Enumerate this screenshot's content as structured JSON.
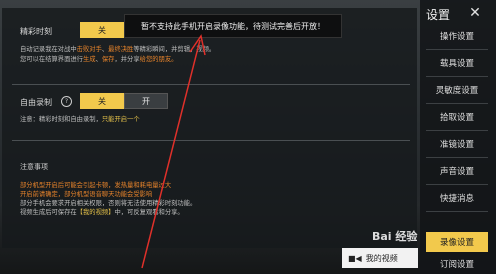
{
  "highlight": {
    "label": "精彩时刻",
    "on": "关",
    "off": "开",
    "desc_line1_a": "自动记录我在对战中",
    "desc_line1_b": "击败对手",
    "desc_line1_c": "、",
    "desc_line1_d": "最终决胜",
    "desc_line1_e": "等精彩瞬间，并剪辑，视频。",
    "desc_line2_a": "您可以在结算界面进行",
    "desc_line2_b": "生成",
    "desc_line2_c": "、",
    "desc_line2_d": "保存",
    "desc_line2_e": "，并分享",
    "desc_line2_f": "给您的朋友。"
  },
  "auto_record": {
    "label": "自由录制",
    "on": "关",
    "off": "开",
    "note_a": "注意：精彩时刻和自由录制，",
    "note_b": "只能开启一个"
  },
  "notes": {
    "title": "注意事项",
    "line1": "部分机型开启后可能会引起卡顿，发热量和耗电量过大",
    "line2": "开启前请确定，部分机型语音聊天功能会受影响",
    "line3": "部分手机会要求开启相关权限，否则将无法使用精彩时刻功能。",
    "line4_a": "视频生成后可保存在",
    "line4_b": "【我的视频】",
    "line4_c": "中，可反复观看和分享。"
  },
  "toast": "暂不支持此手机开启录像功能，待测试完善后开放！",
  "video_button": "我的视频",
  "sidebar": {
    "title": "设置",
    "items": [
      "操作设置",
      "载具设置",
      "灵敏度设置",
      "拾取设置",
      "准镜设置",
      "声音设置",
      "快捷消息",
      "录像设置",
      "订阅设置"
    ]
  },
  "watermark": "Bai 经验",
  "colors": {
    "accent": "#f2c94c",
    "orange": "#e8842b"
  }
}
